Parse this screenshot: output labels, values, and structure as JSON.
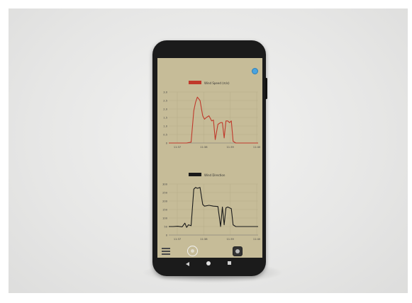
{
  "chart_data": [
    {
      "type": "line",
      "legend": "Wind Speed (m/s)",
      "x_tick_labels": [
        "11:37",
        "11:38",
        "11:39",
        "11:40"
      ],
      "y_tick_labels": [
        "0",
        "0.5",
        "1.0",
        "1.5",
        "2.0",
        "2.5",
        "3.0"
      ],
      "color": "#c0392b",
      "x": [
        0,
        0.05,
        0.1,
        0.15,
        0.2,
        0.25,
        0.28,
        0.3,
        0.32,
        0.35,
        0.38,
        0.4,
        0.42,
        0.45,
        0.48,
        0.5,
        0.52,
        0.55,
        0.58,
        0.6,
        0.62,
        0.64,
        0.66,
        0.68,
        0.7,
        0.72,
        0.75,
        0.8,
        0.9,
        1.0
      ],
      "y": [
        0,
        0,
        0,
        0,
        0,
        0.05,
        1.9,
        2.4,
        2.7,
        2.5,
        1.6,
        1.4,
        1.5,
        1.6,
        1.3,
        1.35,
        0.2,
        1.1,
        1.2,
        1.2,
        0.3,
        1.3,
        1.3,
        1.2,
        1.3,
        0.1,
        0,
        0,
        0,
        0
      ],
      "ylim": [
        0,
        3.0
      ]
    },
    {
      "type": "line",
      "legend": "Wind Direction",
      "x_tick_labels": [
        "11:37",
        "11:38",
        "11:39",
        "11:40"
      ],
      "y_tick_labels": [
        "0",
        "50",
        "100",
        "150",
        "200",
        "250",
        "300"
      ],
      "color": "#1a1a1a",
      "x": [
        0,
        0.05,
        0.1,
        0.15,
        0.18,
        0.2,
        0.22,
        0.25,
        0.28,
        0.3,
        0.32,
        0.35,
        0.38,
        0.4,
        0.45,
        0.5,
        0.55,
        0.58,
        0.6,
        0.62,
        0.64,
        0.66,
        0.68,
        0.7,
        0.72,
        0.75,
        0.8,
        0.9,
        1.0
      ],
      "y": [
        50,
        50,
        52,
        48,
        70,
        45,
        60,
        55,
        270,
        280,
        275,
        280,
        180,
        170,
        175,
        170,
        168,
        50,
        165,
        60,
        160,
        165,
        160,
        155,
        60,
        50,
        50,
        50,
        50
      ],
      "ylim": [
        0,
        300
      ]
    }
  ]
}
